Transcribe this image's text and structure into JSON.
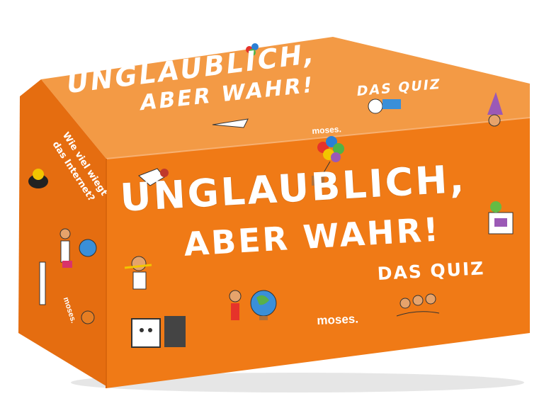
{
  "product": {
    "front": {
      "title_line1": "UNGLAUBLICH,",
      "title_line2": "ABER WAHR!",
      "subtitle": "DAS QUIZ",
      "brand": "moses."
    },
    "top": {
      "title_line1": "UNGLAUBLICH,",
      "title_line2": "ABER WAHR!",
      "subtitle": "DAS QUIZ",
      "brand": "moses."
    },
    "side": {
      "question": "Wie viel wiegt das Internet?",
      "brand": "moses."
    }
  },
  "colors": {
    "box_front": "#f07a16",
    "box_top": "#f39a45",
    "box_side": "#e86e10",
    "text": "#ffffff"
  },
  "icons": [
    "balloon-icon",
    "robot-icon",
    "globe-icon",
    "monitor-icon",
    "girl-character-icon",
    "bird-icon",
    "wizard-icon",
    "basketball-icon"
  ]
}
